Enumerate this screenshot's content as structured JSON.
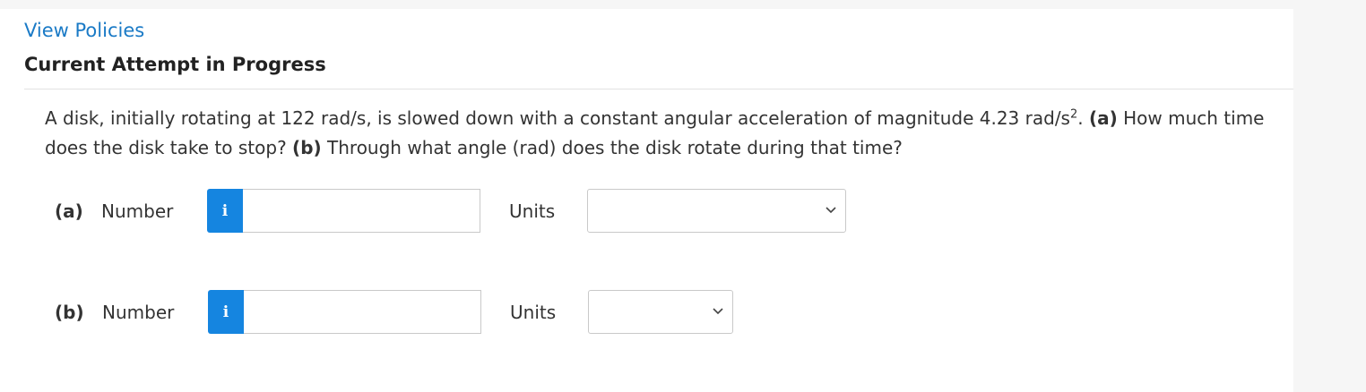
{
  "header": {
    "policies_link": "View Policies",
    "attempt_title": "Current Attempt in Progress"
  },
  "question": {
    "text_1": "A disk, initially rotating at 122 rad/s, is slowed down with a constant angular acceleration of magnitude 4.23 rad/s",
    "exponent": "2",
    "text_2": ". ",
    "part_a_tag": "(a)",
    "part_a_text": " How much time does the disk take to stop? ",
    "part_b_tag": "(b)",
    "part_b_text": " Through what angle (rad) does the disk rotate during that time?"
  },
  "answers": [
    {
      "label": "(a)",
      "number_label": "Number",
      "info_glyph": "i",
      "value": "",
      "units_label": "Units",
      "units_selected": ""
    },
    {
      "label": "(b)",
      "number_label": "Number",
      "info_glyph": "i",
      "value": "",
      "units_label": "Units",
      "units_selected": ""
    }
  ],
  "colors": {
    "link": "#1a7ac6",
    "info_button": "#1585e0"
  }
}
